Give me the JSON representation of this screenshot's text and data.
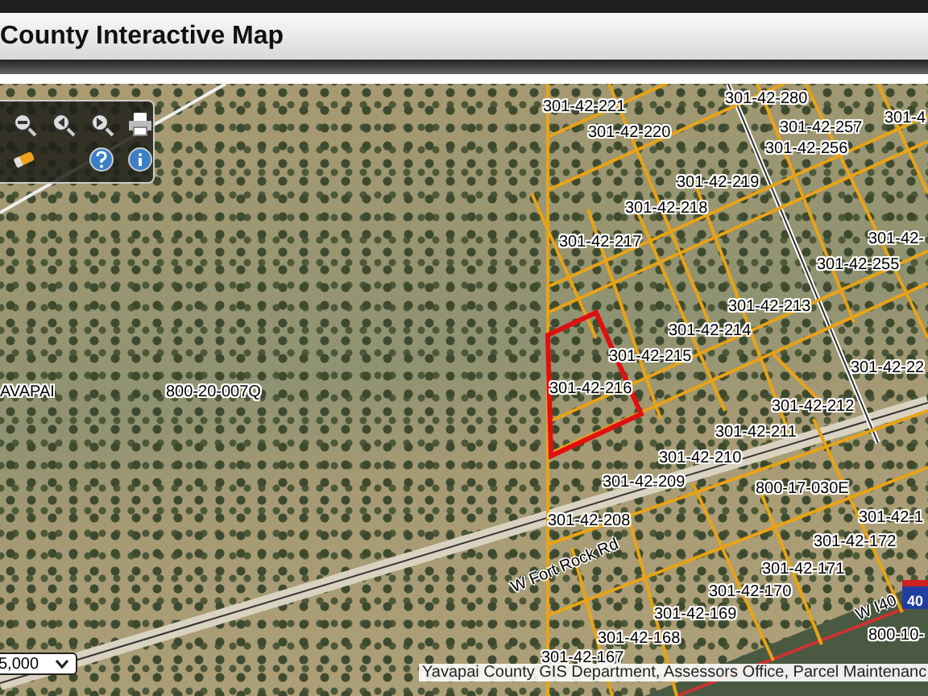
{
  "header": {
    "title": "County Interactive Map"
  },
  "map": {
    "parcel_labels": [
      "301-42-221",
      "301-42-220",
      "301-42-280",
      "301-42-257",
      "301-42-256",
      "301-42-219",
      "301-42-218",
      "301-42-217",
      "301-42-255",
      "301-42-213",
      "301-42-214",
      "301-42-215",
      "301-42-216",
      "301-42-212",
      "301-42-211",
      "301-42-210",
      "301-42-209",
      "800-17-030E",
      "301-42-208",
      "301-42-172",
      "301-42-171",
      "301-42-170",
      "301-42-169",
      "301-42-168",
      "301-42-167",
      "AVAPAI",
      "800-20-007Q",
      "301-4",
      "301-42-",
      "301-42-22",
      "301-42-1",
      "800-10-"
    ],
    "road_labels": [
      "W Fort Rock Rd",
      "W I40"
    ],
    "highway_shield": "40",
    "attribution": "Yavapai County GIS Department, Assessors Office, Parcel Maintenanc",
    "scale": {
      "value": "5,000"
    }
  }
}
